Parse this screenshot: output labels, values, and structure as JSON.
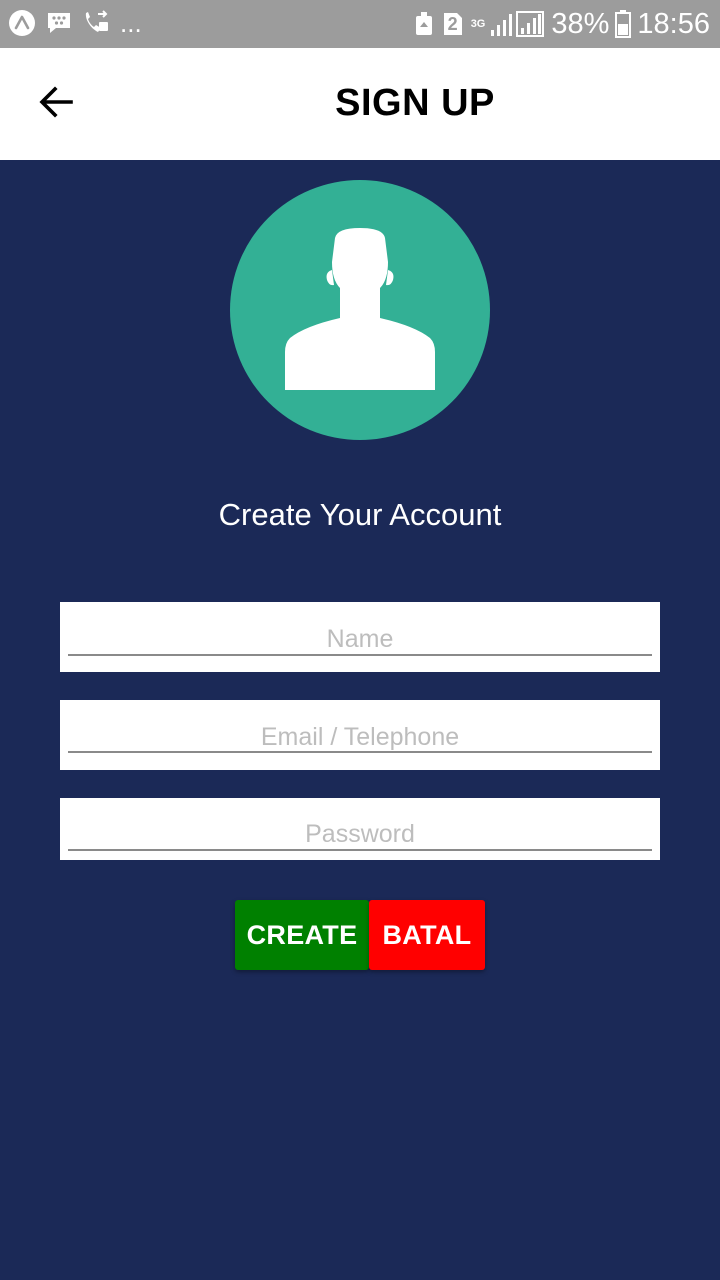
{
  "status_bar": {
    "left_icons": [
      "app-notification-icon",
      "bbm-icon",
      "call-forward-icon"
    ],
    "more": "...",
    "sim_badge": "2",
    "network": "3G",
    "battery_percent": "38%",
    "time": "18:56"
  },
  "app_bar": {
    "title": "SIGN UP",
    "back_icon": "arrow-left-icon"
  },
  "avatar": {
    "icon": "user-silhouette-icon",
    "color": "#33b095"
  },
  "form": {
    "heading": "Create Your Account",
    "fields": [
      {
        "placeholder": "Name",
        "value": ""
      },
      {
        "placeholder": "Email / Telephone",
        "value": ""
      },
      {
        "placeholder": "Password",
        "value": ""
      }
    ],
    "buttons": {
      "create": "CREATE",
      "batal": "BATAL"
    }
  },
  "colors": {
    "background": "#1b2957",
    "status_bar": "#9c9c9c",
    "create_button": "#008000",
    "batal_button": "#ff0000"
  }
}
